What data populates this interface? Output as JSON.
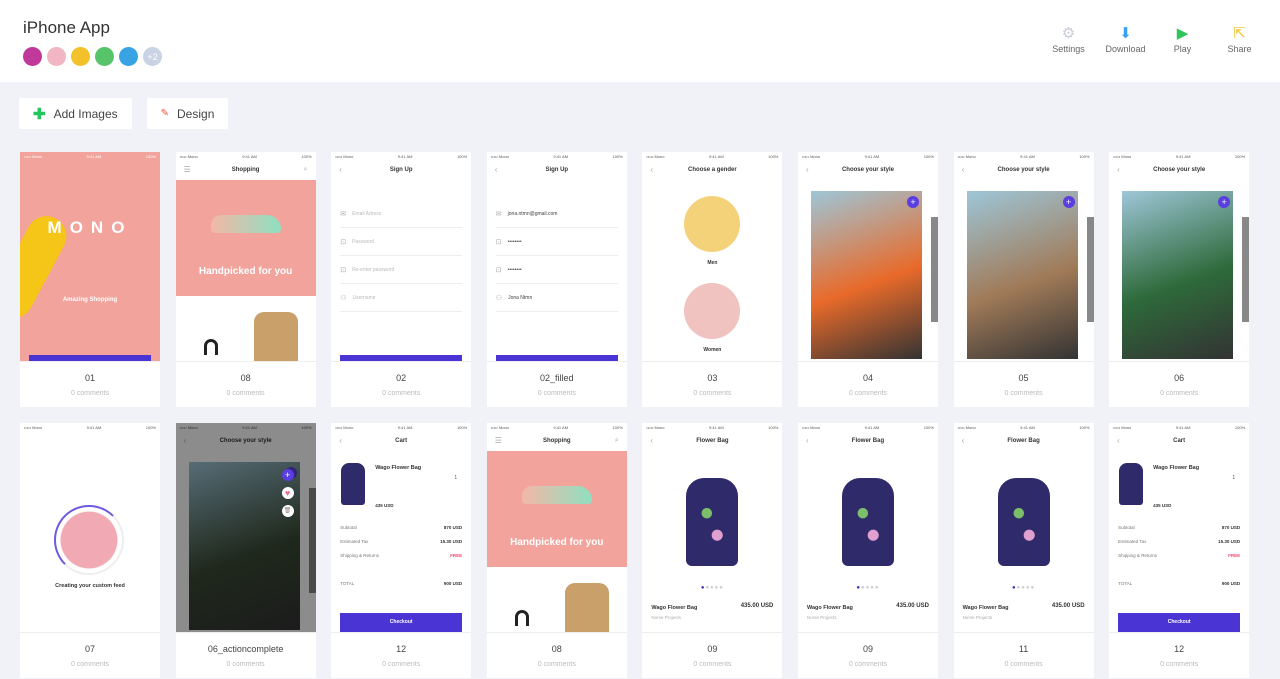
{
  "header": {
    "title": "iPhone App",
    "avatars": [
      {
        "color": "#c0399a"
      },
      {
        "color": "#f1b6c2"
      },
      {
        "color": "#f3c12a"
      },
      {
        "color": "#58c46a"
      },
      {
        "color": "#3aa3e3"
      },
      {
        "color": "#c9d3e3",
        "label": "+2"
      }
    ],
    "actions": [
      {
        "label": "Settings",
        "icon": "gear-icon",
        "glyph": "⚙",
        "color": "#c8ccd8"
      },
      {
        "label": "Download",
        "icon": "download-icon",
        "glyph": "⬇",
        "color": "#3aa0f0"
      },
      {
        "label": "Play",
        "icon": "play-icon",
        "glyph": "▶",
        "color": "#2fc55a"
      },
      {
        "label": "Share",
        "icon": "share-icon",
        "glyph": "⇱",
        "color": "#f2c233"
      }
    ]
  },
  "toolbar": {
    "add_images": "Add Images",
    "design": "Design"
  },
  "status": {
    "carrier": "••••• Mono",
    "time": "9:41 AM",
    "battery": "100%"
  },
  "cards": [
    {
      "name": "01",
      "comments": "0 comments",
      "type": "splash",
      "logo": "MONO",
      "heading": "Amazing Shopping"
    },
    {
      "name": "08",
      "comments": "0 comments",
      "type": "shop",
      "title": "Shopping",
      "heading": "Handpicked for you"
    },
    {
      "name": "02",
      "comments": "0 comments",
      "type": "signup",
      "title": "Sign Up",
      "fields": [
        "Email Adress",
        "Password",
        "Re-enter password",
        "Username"
      ],
      "filled": false
    },
    {
      "name": "02_filled",
      "comments": "0 comments",
      "type": "signup",
      "title": "Sign Up",
      "fields": [
        "jona.ntmn@gmail.com",
        "••••••••",
        "••••••••",
        "Jona Ntmn"
      ],
      "filled": true
    },
    {
      "name": "03",
      "comments": "0 comments",
      "type": "gender",
      "title": "Choose a gender",
      "options": [
        "Men",
        "Women"
      ]
    },
    {
      "name": "04",
      "comments": "0 comments",
      "type": "style",
      "title": "Choose your style",
      "photo": "#e86a2a"
    },
    {
      "name": "05",
      "comments": "0 comments",
      "type": "style",
      "title": "Choose your style",
      "photo": "#a07a58"
    },
    {
      "name": "06",
      "comments": "0 comments",
      "type": "style",
      "title": "Choose your style",
      "photo": "#2e6a3a"
    },
    {
      "name": "07",
      "comments": "0 comments",
      "type": "loading",
      "heading": "Creating your custom feed"
    },
    {
      "name": "06_actioncomplete",
      "comments": "0 comments",
      "type": "styledark",
      "title": "Choose your style",
      "photo": "#3a4a34"
    },
    {
      "name": "12",
      "comments": "0 comments",
      "type": "cart",
      "title": "Cart",
      "item": "Wago Flower Bag",
      "price": "435 USD",
      "qty": "1",
      "rows": [
        [
          "Subtotal",
          "870 USD"
        ],
        [
          "Estimated Tax",
          "15.30 USD"
        ],
        [
          "Shipping & Returns",
          "FREE"
        ]
      ],
      "total": [
        "TOTAL",
        "900 USD"
      ],
      "button": "Checkout"
    },
    {
      "name": "08",
      "comments": "0 comments",
      "type": "shop",
      "title": "Shopping",
      "heading": "Handpicked for you"
    },
    {
      "name": "09",
      "comments": "0 comments",
      "type": "product",
      "title": "Flower Bag",
      "item": "Wago Flower Bag",
      "brand": "Norse Projects",
      "price": "435.00 USD"
    },
    {
      "name": "09",
      "comments": "0 comments",
      "type": "product",
      "title": "Flower Bag",
      "item": "Wago Flower Bag",
      "brand": "Norse Projects",
      "price": "435.00 USD"
    },
    {
      "name": "11",
      "comments": "0 comments",
      "type": "product",
      "title": "Flower Bag",
      "item": "Wago Flower Bag",
      "brand": "Norse Projects",
      "price": "435.00 USD"
    },
    {
      "name": "12",
      "comments": "0 comments",
      "type": "cart",
      "title": "Cart",
      "item": "Wago Flower Bag",
      "price": "435 USD",
      "qty": "1",
      "rows": [
        [
          "Subtotal",
          "870 USD"
        ],
        [
          "Estimated Tax",
          "15.30 USD"
        ],
        [
          "Shipping & Returns",
          "FREE"
        ]
      ],
      "total": [
        "TOTAL",
        "900 USD"
      ],
      "button": "Checkout"
    }
  ]
}
